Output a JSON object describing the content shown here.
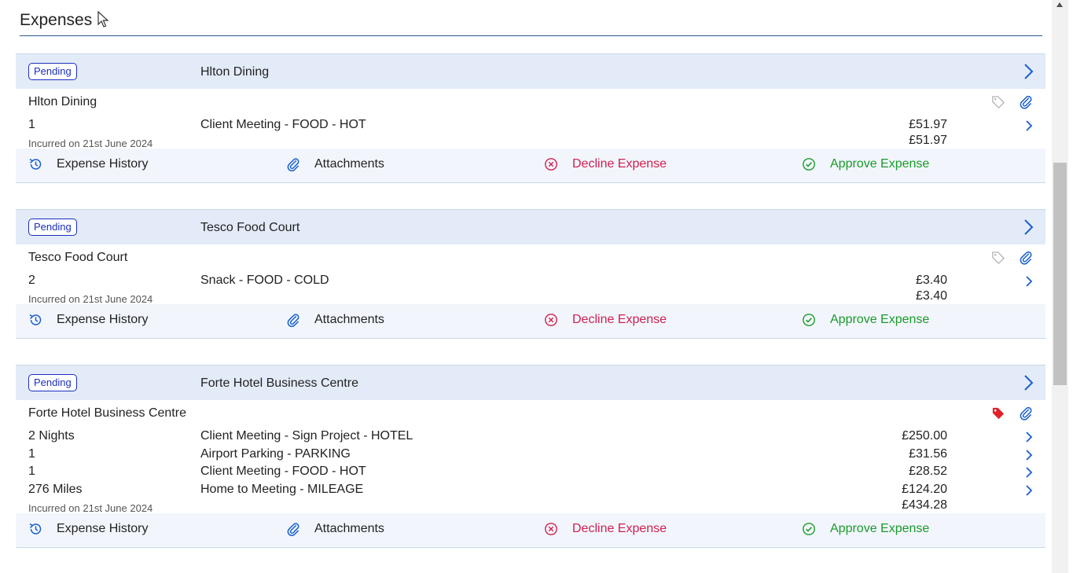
{
  "page": {
    "title": "Expenses"
  },
  "colors": {
    "accent": "#1a5fd0",
    "pending": "#1a2fbf",
    "decline": "#d0204f",
    "approve": "#1a9a2a",
    "tag_active": "#e0202a"
  },
  "actions": {
    "history": "Expense History",
    "attachments": "Attachments",
    "decline": "Decline Expense",
    "approve": "Approve Expense"
  },
  "expenses": [
    {
      "status": "Pending",
      "name": "Hlton Dining",
      "merchant": "Hlton Dining",
      "tag_active": false,
      "lines": [
        {
          "qty": "1",
          "desc": "Client Meeting - FOOD - HOT",
          "amount": "£51.97"
        }
      ],
      "incurred": "Incurred on 21st June 2024",
      "total": "£51.97"
    },
    {
      "status": "Pending",
      "name": "Tesco Food Court",
      "merchant": "Tesco Food Court",
      "tag_active": false,
      "lines": [
        {
          "qty": "2",
          "desc": "Snack - FOOD - COLD",
          "amount": "£3.40"
        }
      ],
      "incurred": "Incurred on 21st June 2024",
      "total": "£3.40"
    },
    {
      "status": "Pending",
      "name": "Forte Hotel Business Centre",
      "merchant": "Forte Hotel Business Centre",
      "tag_active": true,
      "lines": [
        {
          "qty": "2 Nights",
          "desc": "Client Meeting - Sign Project - HOTEL",
          "amount": "£250.00"
        },
        {
          "qty": "1",
          "desc": "Airport Parking - PARKING",
          "amount": "£31.56"
        },
        {
          "qty": "1",
          "desc": "Client Meeting - FOOD - HOT",
          "amount": "£28.52"
        },
        {
          "qty": "276 Miles",
          "desc": "Home to Meeting - MILEAGE",
          "amount": "£124.20"
        }
      ],
      "incurred": "Incurred on 21st June 2024",
      "total": "£434.28"
    }
  ],
  "scrollbar": {
    "position_fraction": 0.28
  }
}
